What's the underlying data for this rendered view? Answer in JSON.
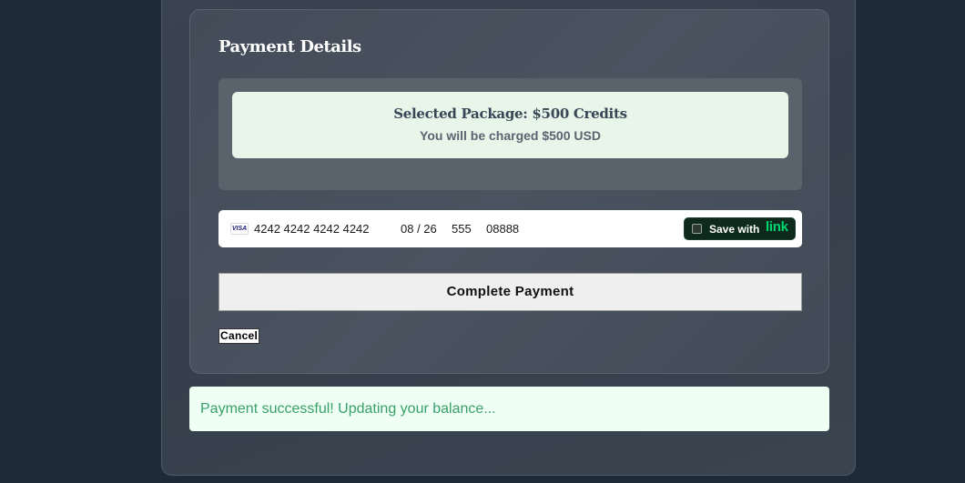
{
  "payment": {
    "title": "Payment Details",
    "package_title": "Selected Package: $500 Credits",
    "package_charge": "You will be charged $500 USD"
  },
  "card": {
    "brand": "VISA",
    "number": "4242 4242 4242 4242",
    "expiry": "08 / 26",
    "cvc": "555",
    "zip": "08888",
    "save_label": "Save with",
    "save_brand": "link"
  },
  "actions": {
    "complete_label": "Complete Payment",
    "cancel_label": "Cancel"
  },
  "status": {
    "message": "Payment successful! Updating your balance..."
  },
  "colors": {
    "background": "#1f2a38",
    "success_text": "#38a169",
    "success_bg": "#f0fff4",
    "package_bg": "#e8f5e9",
    "link_green": "#00d66f"
  }
}
